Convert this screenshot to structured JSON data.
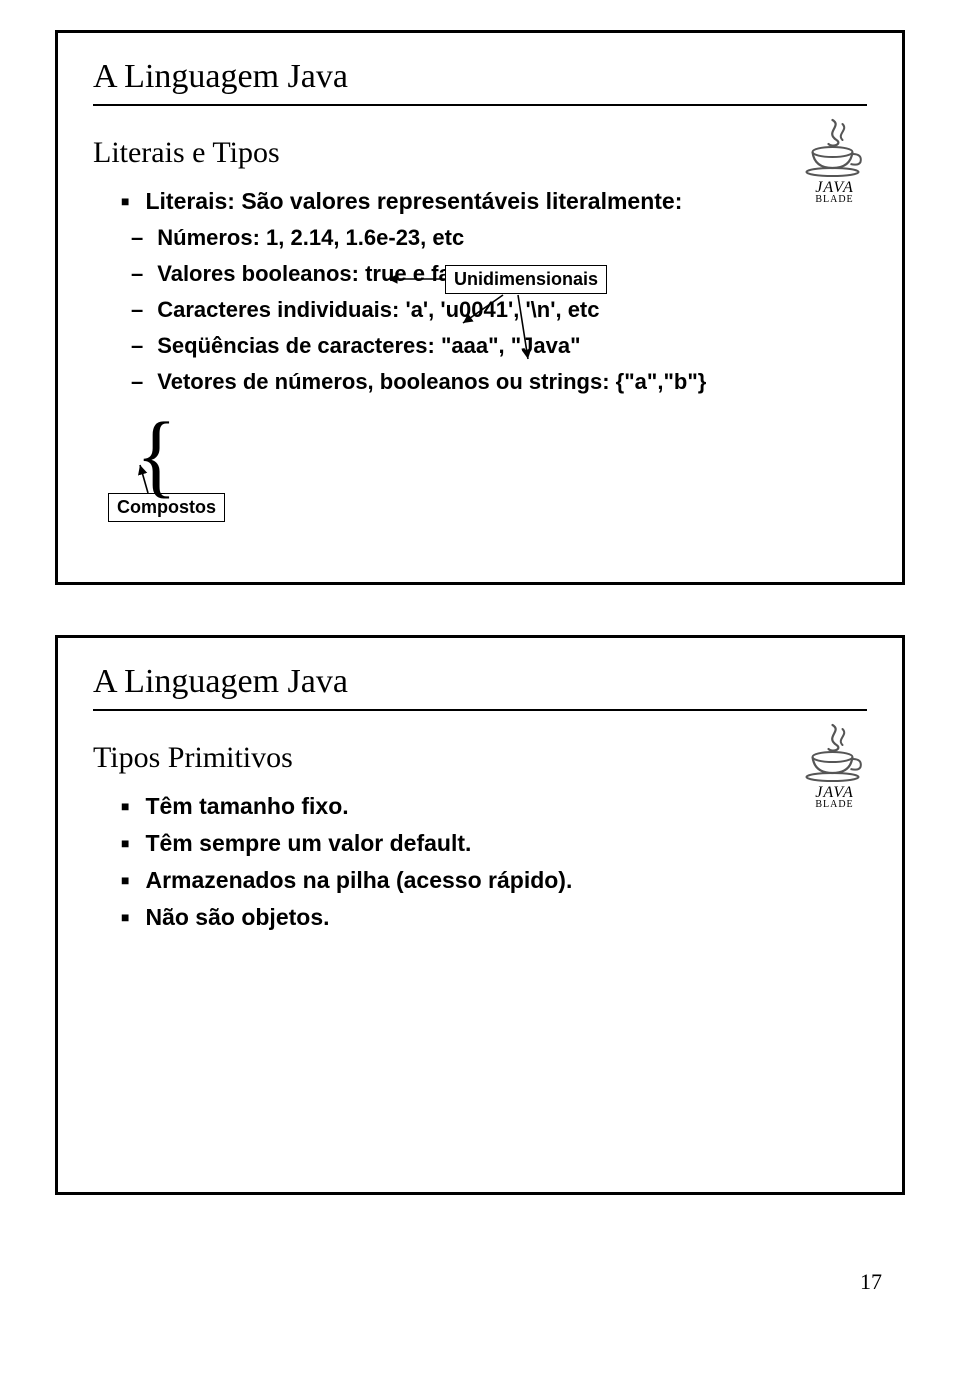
{
  "page_number": "17",
  "slide1": {
    "title": "A Linguagem Java",
    "subtitle": "Literais e Tipos",
    "bullet1": "Literais: São valores representáveis literalmente:",
    "dash1": "Números: 1, 2.14, 1.6e-23, etc",
    "dash2": "Valores booleanos: true e false",
    "dash3": "Caracteres individuais: 'a', 'u0041', '\\n', etc",
    "dash4": "Seqüências de caracteres: \"aaa\", \"Java\"",
    "dash5": "Vetores de números, booleanos ou strings: {\"a\",\"b\"}",
    "callout_uni": "Unidimensionais",
    "callout_comp": "Compostos",
    "logo_text": "JAVA",
    "logo_sub": "BLADE"
  },
  "slide2": {
    "title": "A Linguagem Java",
    "subtitle": "Tipos Primitivos",
    "b1": "Têm tamanho fixo.",
    "b2": "Têm sempre um valor default.",
    "b3": "Armazenados na pilha (acesso rápido).",
    "b4": "Não são objetos.",
    "logo_text": "JAVA",
    "logo_sub": "BLADE"
  }
}
